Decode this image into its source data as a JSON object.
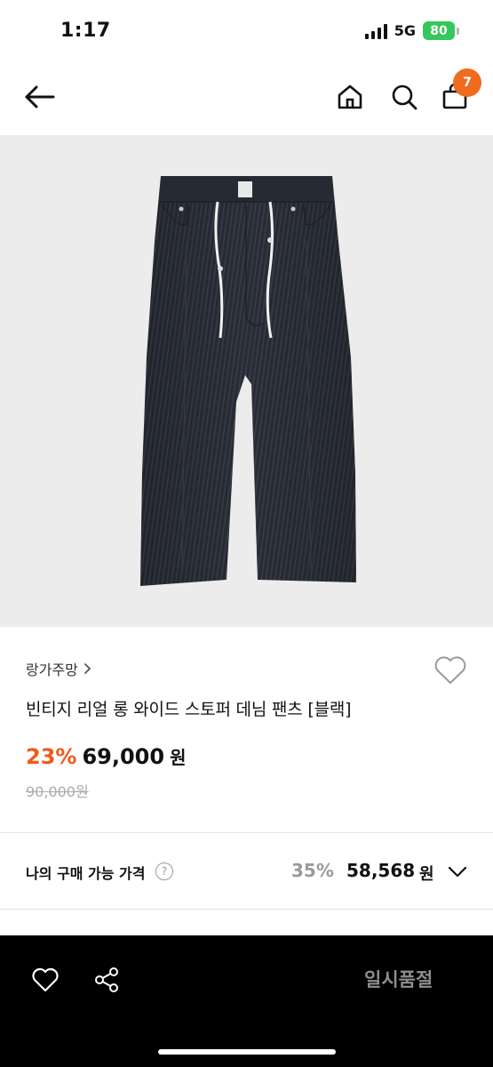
{
  "status_bar": {
    "time": "1:17",
    "network": "5G",
    "battery": "80"
  },
  "nav": {
    "cart_count": "7"
  },
  "product": {
    "brand": "랑가주망",
    "title": "빈티지 리얼 롱 와이드 스토퍼 데님 팬츠 [블랙]",
    "discount": "23%",
    "price": "69,000",
    "price_unit": "원",
    "original_price": "90,000원"
  },
  "my_price": {
    "label": "나의 구매 가능 가격",
    "help": "?",
    "discount": "35%",
    "price": "58,568",
    "unit": "원"
  },
  "bottom_bar": {
    "soldout_label": "일시품절"
  },
  "colors": {
    "accent": "#ef5a1c",
    "badge": "#ef6b1e",
    "battery": "#34c759",
    "denim": "#2a2e38"
  },
  "icons": [
    "back-arrow-icon",
    "home-icon",
    "search-icon",
    "shopping-bag-icon",
    "heart-icon",
    "help-icon",
    "chevron-down-icon",
    "share-icon"
  ]
}
